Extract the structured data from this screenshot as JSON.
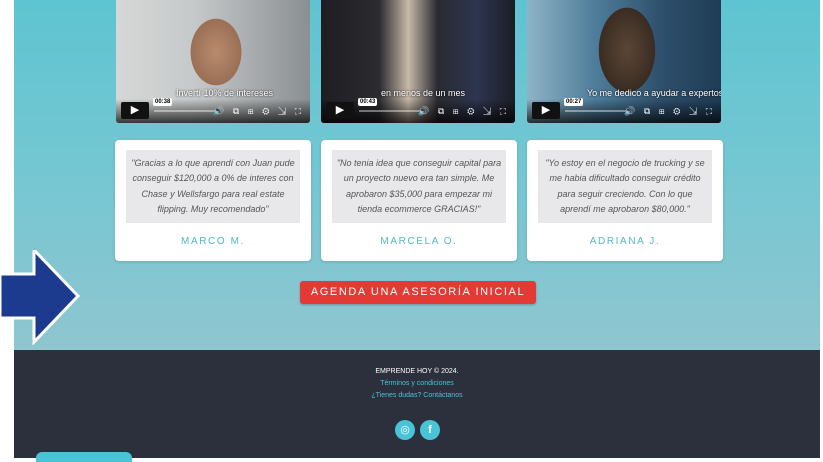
{
  "videos": [
    {
      "time": "00:38",
      "caption": "Invertí 10% de intereses",
      "controls": "🔊 ⧉ ⊞ ⚙ ⇲ ⛶"
    },
    {
      "time": "00:43",
      "caption": "en menos de un mes",
      "controls": "🔊 ⧉ ⊞ ⚙ ⇲ ⛶"
    },
    {
      "time": "00:27",
      "caption": "Yo me dedico a ayudar a expertos",
      "controls": "🔊 ⧉ ⊞ ⚙ ⇲ ⛶"
    }
  ],
  "testimonials": [
    {
      "quote": "\"Gracias a lo que aprendí con Juan pude conseguir $120,000 a 0% de interes con Chase y Wellsfargo para real estate flipping. Muy recomendado\"",
      "author": "MARCO M."
    },
    {
      "quote": "\"No tenia idea que conseguir capital para un proyecto nuevo era tan simple. Me aprobaron $35,000 para empezar mi tienda ecommerce GRACIAS!\"",
      "author": "MARCELA O."
    },
    {
      "quote": "\"Yo estoy en el negocio de trucking y se me habia dificultado conseguir crédito para seguir creciendo. Con lo que aprendí me aprobaron $80,000.\"",
      "author": "ADRIANA J."
    }
  ],
  "cta": {
    "label": "AGENDA UNA ASESORÍA INICIAL"
  },
  "footer": {
    "copyright": "EMPRENDE HOY © 2024.",
    "terms": "Términos y condiciones",
    "contact": "¿Tienes dudas? Contáctanos",
    "social": [
      {
        "icon": "instagram-icon",
        "glyph": "◎"
      },
      {
        "icon": "facebook-icon",
        "glyph": "f"
      }
    ]
  },
  "colors": {
    "accent": "#49c3d6",
    "cta": "#e53935",
    "footer": "#2c303d",
    "arrow": "#1c3b8e"
  }
}
